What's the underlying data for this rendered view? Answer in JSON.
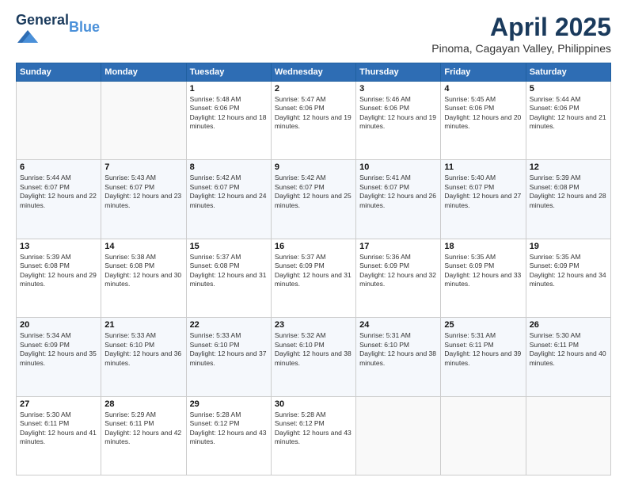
{
  "header": {
    "logo_line1": "General",
    "logo_line2": "Blue",
    "title": "April 2025",
    "subtitle": "Pinoma, Cagayan Valley, Philippines"
  },
  "columns": [
    "Sunday",
    "Monday",
    "Tuesday",
    "Wednesday",
    "Thursday",
    "Friday",
    "Saturday"
  ],
  "weeks": [
    [
      {
        "day": "",
        "text": ""
      },
      {
        "day": "",
        "text": ""
      },
      {
        "day": "1",
        "text": "Sunrise: 5:48 AM\nSunset: 6:06 PM\nDaylight: 12 hours and 18 minutes."
      },
      {
        "day": "2",
        "text": "Sunrise: 5:47 AM\nSunset: 6:06 PM\nDaylight: 12 hours and 19 minutes."
      },
      {
        "day": "3",
        "text": "Sunrise: 5:46 AM\nSunset: 6:06 PM\nDaylight: 12 hours and 19 minutes."
      },
      {
        "day": "4",
        "text": "Sunrise: 5:45 AM\nSunset: 6:06 PM\nDaylight: 12 hours and 20 minutes."
      },
      {
        "day": "5",
        "text": "Sunrise: 5:44 AM\nSunset: 6:06 PM\nDaylight: 12 hours and 21 minutes."
      }
    ],
    [
      {
        "day": "6",
        "text": "Sunrise: 5:44 AM\nSunset: 6:07 PM\nDaylight: 12 hours and 22 minutes."
      },
      {
        "day": "7",
        "text": "Sunrise: 5:43 AM\nSunset: 6:07 PM\nDaylight: 12 hours and 23 minutes."
      },
      {
        "day": "8",
        "text": "Sunrise: 5:42 AM\nSunset: 6:07 PM\nDaylight: 12 hours and 24 minutes."
      },
      {
        "day": "9",
        "text": "Sunrise: 5:42 AM\nSunset: 6:07 PM\nDaylight: 12 hours and 25 minutes."
      },
      {
        "day": "10",
        "text": "Sunrise: 5:41 AM\nSunset: 6:07 PM\nDaylight: 12 hours and 26 minutes."
      },
      {
        "day": "11",
        "text": "Sunrise: 5:40 AM\nSunset: 6:07 PM\nDaylight: 12 hours and 27 minutes."
      },
      {
        "day": "12",
        "text": "Sunrise: 5:39 AM\nSunset: 6:08 PM\nDaylight: 12 hours and 28 minutes."
      }
    ],
    [
      {
        "day": "13",
        "text": "Sunrise: 5:39 AM\nSunset: 6:08 PM\nDaylight: 12 hours and 29 minutes."
      },
      {
        "day": "14",
        "text": "Sunrise: 5:38 AM\nSunset: 6:08 PM\nDaylight: 12 hours and 30 minutes."
      },
      {
        "day": "15",
        "text": "Sunrise: 5:37 AM\nSunset: 6:08 PM\nDaylight: 12 hours and 31 minutes."
      },
      {
        "day": "16",
        "text": "Sunrise: 5:37 AM\nSunset: 6:09 PM\nDaylight: 12 hours and 31 minutes."
      },
      {
        "day": "17",
        "text": "Sunrise: 5:36 AM\nSunset: 6:09 PM\nDaylight: 12 hours and 32 minutes."
      },
      {
        "day": "18",
        "text": "Sunrise: 5:35 AM\nSunset: 6:09 PM\nDaylight: 12 hours and 33 minutes."
      },
      {
        "day": "19",
        "text": "Sunrise: 5:35 AM\nSunset: 6:09 PM\nDaylight: 12 hours and 34 minutes."
      }
    ],
    [
      {
        "day": "20",
        "text": "Sunrise: 5:34 AM\nSunset: 6:09 PM\nDaylight: 12 hours and 35 minutes."
      },
      {
        "day": "21",
        "text": "Sunrise: 5:33 AM\nSunset: 6:10 PM\nDaylight: 12 hours and 36 minutes."
      },
      {
        "day": "22",
        "text": "Sunrise: 5:33 AM\nSunset: 6:10 PM\nDaylight: 12 hours and 37 minutes."
      },
      {
        "day": "23",
        "text": "Sunrise: 5:32 AM\nSunset: 6:10 PM\nDaylight: 12 hours and 38 minutes."
      },
      {
        "day": "24",
        "text": "Sunrise: 5:31 AM\nSunset: 6:10 PM\nDaylight: 12 hours and 38 minutes."
      },
      {
        "day": "25",
        "text": "Sunrise: 5:31 AM\nSunset: 6:11 PM\nDaylight: 12 hours and 39 minutes."
      },
      {
        "day": "26",
        "text": "Sunrise: 5:30 AM\nSunset: 6:11 PM\nDaylight: 12 hours and 40 minutes."
      }
    ],
    [
      {
        "day": "27",
        "text": "Sunrise: 5:30 AM\nSunset: 6:11 PM\nDaylight: 12 hours and 41 minutes."
      },
      {
        "day": "28",
        "text": "Sunrise: 5:29 AM\nSunset: 6:11 PM\nDaylight: 12 hours and 42 minutes."
      },
      {
        "day": "29",
        "text": "Sunrise: 5:28 AM\nSunset: 6:12 PM\nDaylight: 12 hours and 43 minutes."
      },
      {
        "day": "30",
        "text": "Sunrise: 5:28 AM\nSunset: 6:12 PM\nDaylight: 12 hours and 43 minutes."
      },
      {
        "day": "",
        "text": ""
      },
      {
        "day": "",
        "text": ""
      },
      {
        "day": "",
        "text": ""
      }
    ]
  ]
}
